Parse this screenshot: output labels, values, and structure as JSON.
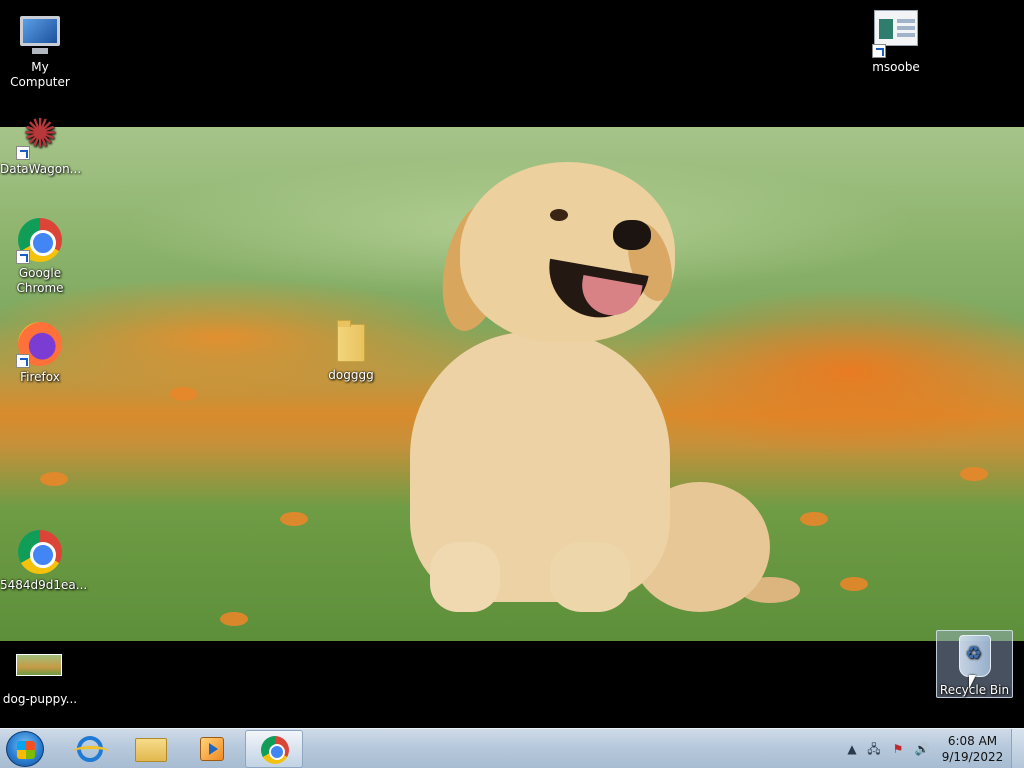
{
  "desktop": {
    "icons": [
      {
        "label": "My Computer",
        "icon": "computer-icon"
      },
      {
        "label": "DataWagon...",
        "icon": "datawagon-icon"
      },
      {
        "label": "Google Chrome",
        "icon": "chrome-icon"
      },
      {
        "label": "Firefox",
        "icon": "firefox-icon"
      },
      {
        "label": "5484d9d1ea...",
        "icon": "chrome-icon"
      },
      {
        "label": "dog-puppy...",
        "icon": "image-file-icon"
      },
      {
        "label": "msoobe",
        "icon": "msoobe-icon"
      },
      {
        "label": "dogggg",
        "icon": "folder-icon"
      },
      {
        "label": "Recycle Bin",
        "icon": "recycle-bin-icon"
      }
    ]
  },
  "taskbar": {
    "pinned": [
      {
        "name": "Internet Explorer",
        "icon": "ie-icon"
      },
      {
        "name": "Windows Explorer",
        "icon": "explorer-folder-icon"
      },
      {
        "name": "Windows Media Player",
        "icon": "media-player-icon"
      },
      {
        "name": "Google Chrome",
        "icon": "chrome-icon",
        "active": true
      }
    ],
    "tray": {
      "icons": [
        "show-hidden-icons-arrow",
        "network-icon",
        "action-center-icon",
        "volume-icon"
      ]
    },
    "clock": {
      "time": "6:08 AM",
      "date": "9/19/2022"
    }
  },
  "colors": {
    "taskbar": "#b7c9dc",
    "desktop_background": "#000000"
  }
}
